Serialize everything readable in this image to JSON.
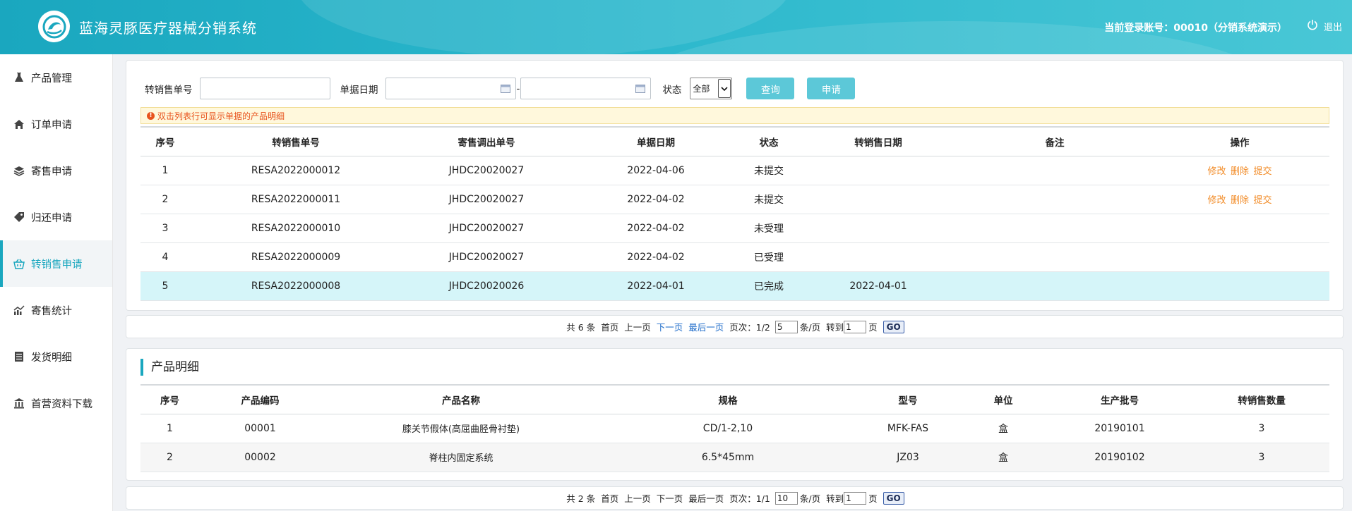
{
  "header": {
    "app_title": "蓝海灵豚医疗器械分销系统",
    "account_text": "当前登录账号：00010（分销系统演示）",
    "logout_label": "退出",
    "logo_icon": "dolphin-logo-icon"
  },
  "sidebar": {
    "items": [
      {
        "label": "产品管理",
        "icon": "flask-icon"
      },
      {
        "label": "订单申请",
        "icon": "home-icon"
      },
      {
        "label": "寄售申请",
        "icon": "layers-icon"
      },
      {
        "label": "归还申请",
        "icon": "tag-icon"
      },
      {
        "label": "转销售申请",
        "icon": "basket-icon"
      },
      {
        "label": "寄售统计",
        "icon": "chart-icon"
      },
      {
        "label": "发货明细",
        "icon": "list-icon"
      },
      {
        "label": "首营资料下载",
        "icon": "bank-icon"
      }
    ]
  },
  "filters": {
    "order_no_label": "转销售单号",
    "order_no_value": "",
    "date_label": "单据日期",
    "date_from": "",
    "date_sep": "-",
    "date_to": "",
    "status_label": "状态",
    "status_value": "全部",
    "query_label": "查询",
    "apply_label": "申请"
  },
  "tip": "双击列表行可显示单据的产品明细",
  "orders": {
    "headers": [
      "序号",
      "转销售单号",
      "寄售调出单号",
      "单据日期",
      "状态",
      "转销售日期",
      "备注",
      "操作"
    ],
    "rows": [
      {
        "no": "1",
        "resale_no": "RESA2022000012",
        "consign_no": "JHDC20020027",
        "date": "2022-04-06",
        "status": "未提交",
        "resale_date": "",
        "remark": "",
        "ops": [
          "修改",
          "删除",
          "提交"
        ]
      },
      {
        "no": "2",
        "resale_no": "RESA2022000011",
        "consign_no": "JHDC20020027",
        "date": "2022-04-02",
        "status": "未提交",
        "resale_date": "",
        "remark": "",
        "ops": [
          "修改",
          "删除",
          "提交"
        ]
      },
      {
        "no": "3",
        "resale_no": "RESA2022000010",
        "consign_no": "JHDC20020027",
        "date": "2022-04-02",
        "status": "未受理",
        "resale_date": "",
        "remark": "",
        "ops": []
      },
      {
        "no": "4",
        "resale_no": "RESA2022000009",
        "consign_no": "JHDC20020027",
        "date": "2022-04-02",
        "status": "已受理",
        "resale_date": "",
        "remark": "",
        "ops": []
      },
      {
        "no": "5",
        "resale_no": "RESA2022000008",
        "consign_no": "JHDC20020026",
        "date": "2022-04-01",
        "status": "已完成",
        "resale_date": "2022-04-01",
        "remark": "",
        "ops": []
      }
    ]
  },
  "pager1": {
    "total": "共 6 条",
    "first": "首页",
    "prev": "上一页",
    "next": "下一页",
    "last": "最后一页",
    "page_label": "页次：1/2",
    "per_page": "5",
    "per_page_unit": "条/页",
    "goto_label": "转到",
    "goto_value": "1",
    "page_unit": "页",
    "go_label": "GO"
  },
  "detail": {
    "title": "产品明细",
    "headers": [
      "序号",
      "产品编码",
      "产品名称",
      "规格",
      "型号",
      "单位",
      "生产批号",
      "转销售数量"
    ],
    "rows": [
      {
        "no": "1",
        "code": "00001",
        "name": "膝关节假体(高屈曲胫骨衬垫)",
        "spec": "CD/1-2,10",
        "model": "MFK-FAS",
        "unit": "盒",
        "batch": "20190101",
        "qty": "3"
      },
      {
        "no": "2",
        "code": "00002",
        "name": "脊柱内固定系统",
        "spec": "6.5*45mm",
        "model": "JZ03",
        "unit": "盒",
        "batch": "20190102",
        "qty": "3"
      }
    ]
  },
  "pager2": {
    "total": "共 2 条",
    "first": "首页",
    "prev": "上一页",
    "next": "下一页",
    "last": "最后一页",
    "page_label": "页次：1/1",
    "per_page": "10",
    "per_page_unit": "条/页",
    "goto_label": "转到",
    "goto_value": "1",
    "page_unit": "页",
    "go_label": "GO"
  }
}
